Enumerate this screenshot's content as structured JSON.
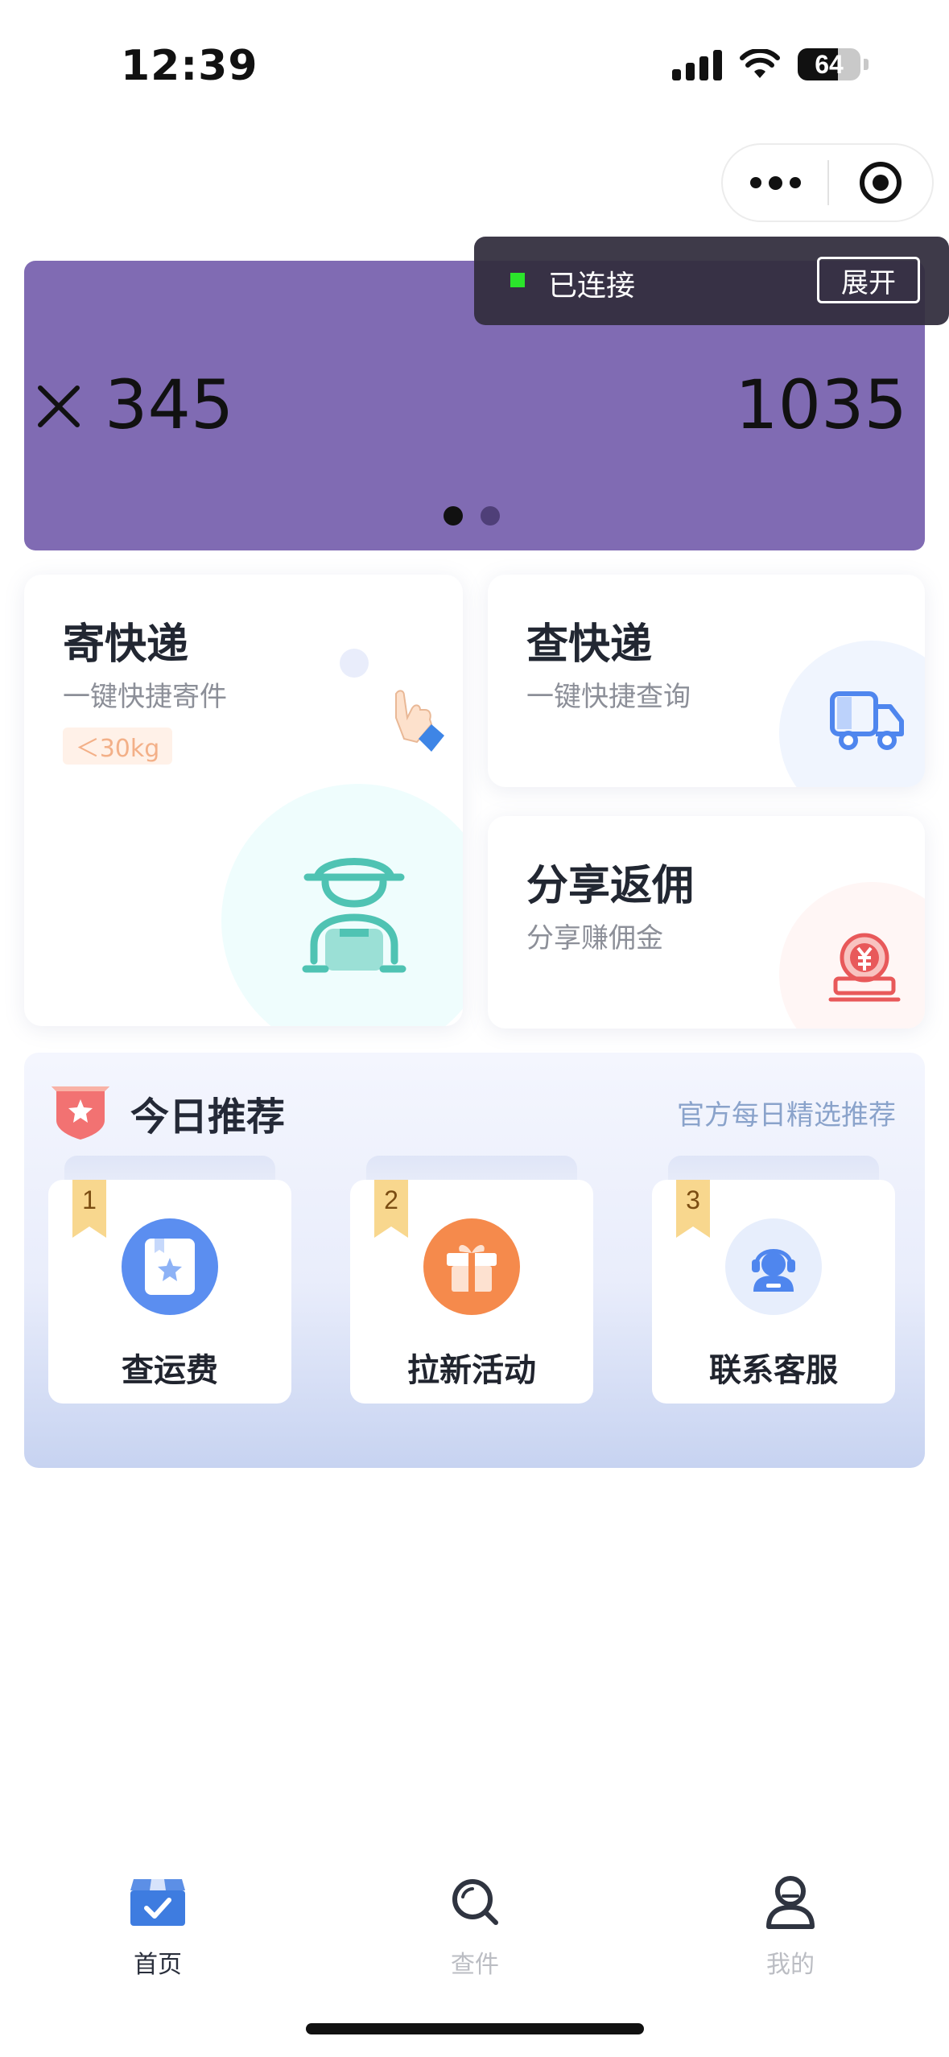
{
  "status_bar": {
    "time": "12:39",
    "battery": "64",
    "battery_level": 0.64
  },
  "banner": {
    "left_value": "345",
    "right_value": "1035",
    "slide_count": 2,
    "active_slide": 1,
    "background": "#806bb3"
  },
  "toast": {
    "status": "已连接",
    "expand_label": "展开",
    "status_color": "#2be52b"
  },
  "services": {
    "send": {
      "title": "寄快递",
      "subtitle": "一键快捷寄件",
      "tag": "＜30kg",
      "icon": "courier-icon"
    },
    "query": {
      "title": "查快递",
      "subtitle": "一键快捷查询",
      "icon": "truck-icon"
    },
    "share": {
      "title": "分享返佣",
      "subtitle": "分享赚佣金",
      "icon": "coin-icon"
    }
  },
  "recommend": {
    "title": "今日推荐",
    "more": "官方每日精选推荐",
    "items": [
      {
        "rank": "1",
        "label": "查运费",
        "icon": "bookmark-star-icon",
        "color": "#5b8ef0"
      },
      {
        "rank": "2",
        "label": "拉新活动",
        "icon": "gift-icon",
        "color": "#f58a4c"
      },
      {
        "rank": "3",
        "label": "联系客服",
        "icon": "customer-service-icon",
        "color": "#e7eefc"
      }
    ]
  },
  "tabbar": {
    "items": [
      {
        "label": "首页",
        "icon": "home-box-icon",
        "active": true
      },
      {
        "label": "查件",
        "icon": "search-icon",
        "active": false
      },
      {
        "label": "我的",
        "icon": "profile-icon",
        "active": false
      }
    ]
  }
}
